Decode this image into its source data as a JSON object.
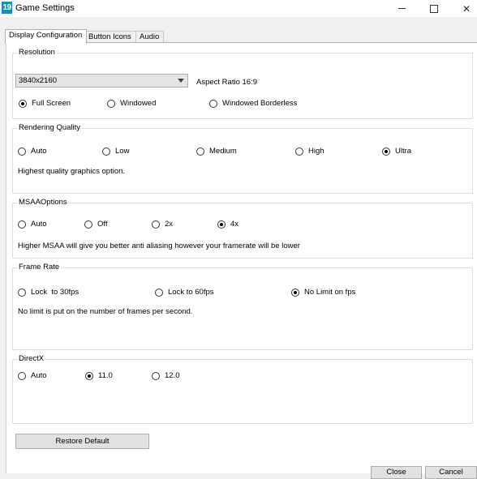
{
  "window": {
    "icon_text": "19",
    "title": "Game Settings",
    "minimize_label": "",
    "maximize_label": "",
    "close_symbol": "✕"
  },
  "tabs": [
    {
      "label": "Display Configuration",
      "active": true
    },
    {
      "label": "Button Icons",
      "active": false
    },
    {
      "label": "Audio",
      "active": false
    }
  ],
  "resolution": {
    "legend": "Resolution",
    "selected": "3840x2160",
    "aspect": "Aspect Ratio 16:9",
    "modes": [
      {
        "label": "Full Screen",
        "checked": true
      },
      {
        "label": "Windowed",
        "checked": false
      },
      {
        "label": "Windowed Borderless",
        "checked": false
      }
    ]
  },
  "rendering": {
    "legend": "Rendering Quality",
    "options": [
      {
        "label": "Auto",
        "checked": false
      },
      {
        "label": "Low",
        "checked": false
      },
      {
        "label": "Medium",
        "checked": false
      },
      {
        "label": "High",
        "checked": false
      },
      {
        "label": "Ultra",
        "checked": true
      }
    ],
    "description": "Highest quality graphics option."
  },
  "msaa": {
    "legend": "MSAAOptions",
    "options": [
      {
        "label": "Auto",
        "checked": false
      },
      {
        "label": "Off",
        "checked": false
      },
      {
        "label": "2x",
        "checked": false
      },
      {
        "label": "4x",
        "checked": true
      }
    ],
    "description": "Higher MSAA will give you better anti aliasing however your framerate will be lower"
  },
  "framerate": {
    "legend": "Frame Rate",
    "options": [
      {
        "label": "Lock  to 30fps",
        "checked": false
      },
      {
        "label": "Lock to 60fps",
        "checked": false
      },
      {
        "label": "No Limit on fps",
        "checked": true
      }
    ],
    "description": "No limit is put on the number of frames per second."
  },
  "directx": {
    "legend": "DirectX",
    "options": [
      {
        "label": "Auto",
        "checked": false
      },
      {
        "label": "11.0",
        "checked": true
      },
      {
        "label": "12.0",
        "checked": false
      }
    ]
  },
  "buttons": {
    "restore": "Restore Default",
    "close": "Close",
    "cancel": "Cancel"
  }
}
